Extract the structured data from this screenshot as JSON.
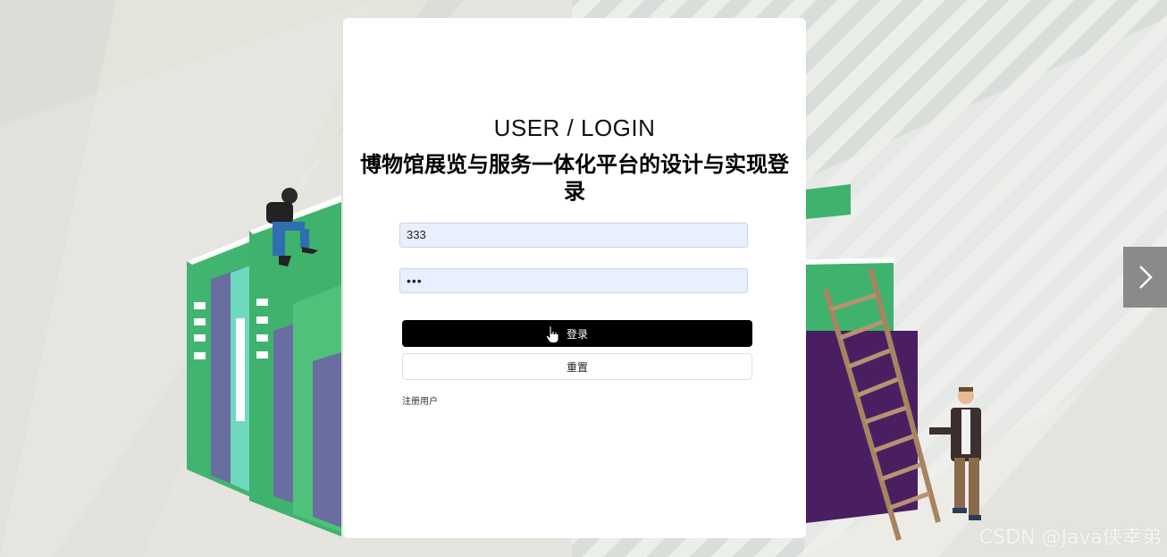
{
  "login": {
    "subtitle": "USER / LOGIN",
    "title": "博物馆展览与服务一体化平台的设计与实现登录",
    "username_value": "333",
    "password_mask": "•••",
    "login_label": "登录",
    "reset_label": "重置",
    "register_label": "注册用户"
  },
  "carousel": {
    "next_icon": "chevron-right-icon"
  },
  "watermark": "CSDN @Java侠幸弟",
  "colors": {
    "accent": "#000000",
    "book_green": "#3db36a",
    "book_purple": "#6c6e9e",
    "book_teal": "#6cd9c0",
    "book_dark_purple": "#4b2465"
  }
}
